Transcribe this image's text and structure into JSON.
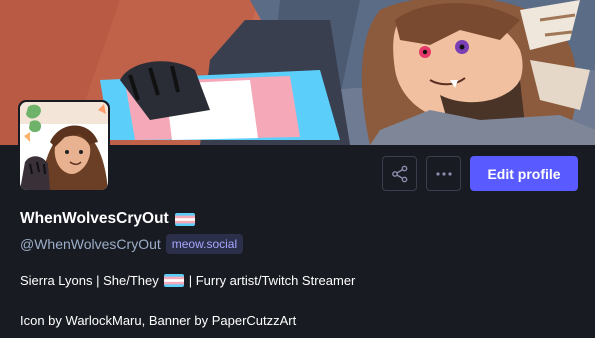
{
  "profile": {
    "display_name": "WhenWolvesCryOut",
    "handle": "@WhenWolvesCryOut",
    "domain_badge": "meow.social",
    "bio_line1_prefix": "Sierra Lyons | She/They",
    "bio_line1_suffix": "| Furry artist/Twitch Streamer",
    "bio_line2": "Icon by WarlockMaru, Banner by PaperCutzzArt"
  },
  "actions": {
    "share_icon": "share-icon",
    "more_icon": "more-icon",
    "edit_label": "Edit profile"
  },
  "colors": {
    "background": "#191b22",
    "accent": "#595aff",
    "secondary_text": "#9baec8",
    "flag_blue": "#5bcefa",
    "flag_pink": "#f5a9b8",
    "flag_white": "#ffffff"
  }
}
